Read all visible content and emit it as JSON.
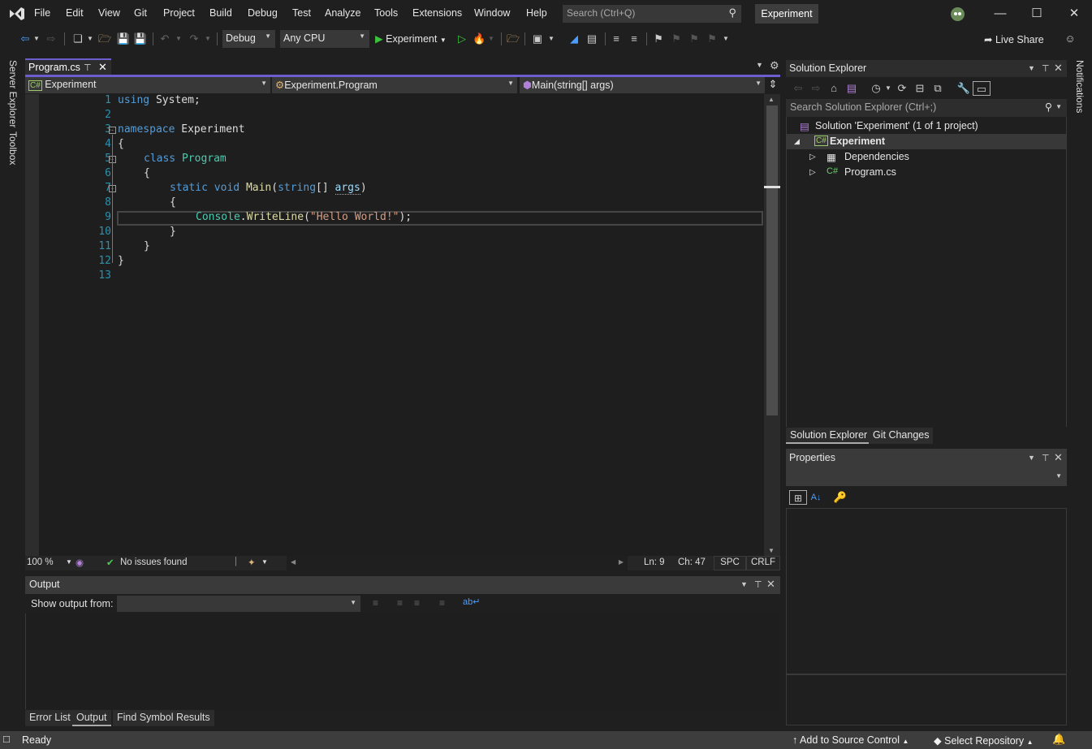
{
  "menubar": {
    "items": [
      "File",
      "Edit",
      "View",
      "Git",
      "Project",
      "Build",
      "Debug",
      "Test",
      "Analyze",
      "Tools",
      "Extensions",
      "Window",
      "Help"
    ],
    "search_placeholder": "Search (Ctrl+Q)",
    "solution_name": "Experiment"
  },
  "toolbar": {
    "configuration": "Debug",
    "platform": "Any CPU",
    "start_label": "Experiment",
    "live_share": "Live Share"
  },
  "left_rail": {
    "server_explorer": "Server Explorer",
    "toolbox": "Toolbox"
  },
  "right_rail": {
    "notifications": "Notifications"
  },
  "editor": {
    "tab_title": "Program.cs",
    "nav": {
      "project": "Experiment",
      "type": "Experiment.Program",
      "member": "Main(string[] args)"
    },
    "line_numbers": [
      "1",
      "2",
      "3",
      "4",
      "5",
      "6",
      "7",
      "8",
      "9",
      "10",
      "11",
      "12",
      "13"
    ],
    "code": {
      "l1_kw": "using",
      "l1_rest": " System;",
      "l3_kw": "namespace",
      "l3_rest": " Experiment",
      "l4": "{",
      "l5_kw": "class",
      "l5_ty": "Program",
      "l6": "{",
      "l7_kw1": "static",
      "l7_kw2": "void",
      "l7_fn": "Main",
      "l7_p1": "(",
      "l7_kw3": "string",
      "l7_p2": "[] ",
      "l7_pm": "args",
      "l7_p3": ")",
      "l8": "{",
      "l9_ty": "Console",
      "l9_dot": ".",
      "l9_fn": "WriteLine",
      "l9_p1": "(",
      "l9_st": "\"Hello World!\"",
      "l9_p2": ");",
      "l10": "}",
      "l11": "}",
      "l12": "}"
    },
    "status": {
      "zoom": "100 %",
      "issues": "No issues found",
      "line": "Ln: 9",
      "col": "Ch: 47",
      "whitespace": "SPC",
      "line_ending": "CRLF"
    }
  },
  "output": {
    "title": "Output",
    "show_from_label": "Show output from:",
    "source_value": "",
    "tabs": [
      "Error List",
      "Output",
      "Find Symbol Results"
    ],
    "active_tab": "Output"
  },
  "solution_explorer": {
    "title": "Solution Explorer",
    "search_placeholder": "Search Solution Explorer (Ctrl+;)",
    "tree": [
      {
        "label": "Solution 'Experiment' (1 of 1 project)",
        "level": 0
      },
      {
        "label": "Experiment",
        "level": 1,
        "expanded": true,
        "selected": true
      },
      {
        "label": "Dependencies",
        "level": 2
      },
      {
        "label": "Program.cs",
        "level": 2
      }
    ],
    "tabs": [
      "Solution Explorer",
      "Git Changes"
    ]
  },
  "properties": {
    "title": "Properties"
  },
  "statusbar": {
    "ready": "Ready",
    "add_source": "Add to Source Control",
    "select_repo": "Select Repository"
  },
  "colors": {
    "accent": "#6c5ecf",
    "keyword": "#569cd6",
    "type": "#4ec9b0",
    "string": "#d69d85",
    "line_number": "#2b91af",
    "success": "#4ec94e"
  }
}
